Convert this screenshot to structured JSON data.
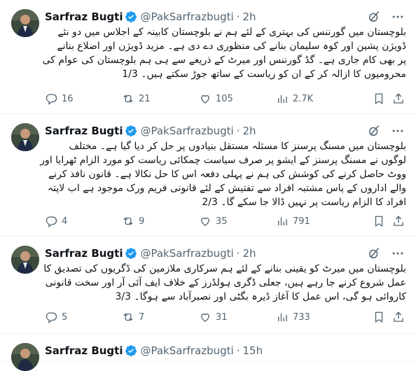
{
  "tweets": [
    {
      "name": "Sarfraz Bugti",
      "handle": "@PakSarfrazbugti",
      "time": "2h",
      "lines": [
        "بلوچستان میں گورننس کی بہتری کے لئے ہم نے بلوچستان کابینہ کے اجلاس میں  دو نئے",
        "ڈویژن  پشین اور کوہ سلیمان بنانے کی منظوری دے دی ہے۔ مزید ڈویژن اور اضلاع بنانے",
        "پر بھی کام جاری ہے۔ گڈ گورننس اور میرٹ کے ذریعے سے ہی ہم بلوچستان کی عوام کی",
        "محرومیوں کا ازالہ کر کے ان کو ریاست کے ساتھ جوڑ سکتے ہیں۔ 1/3"
      ],
      "replies": "16",
      "reposts": "21",
      "likes": "105",
      "views": "2.7K"
    },
    {
      "name": "Sarfraz Bugti",
      "handle": "@PakSarfrazbugti",
      "time": "2h",
      "lines": [
        "بلوچستان میں مسنگ پرسنز کا مسئلہ مستقل بنیادوں پر حل کر دیا گیا ہے۔ مختلف",
        "لوگوں نے مسنگ پرسنز کے ایشو پر صرف سیاست چمکائی ریاست کو مورد الزام ٹھرایا اور",
        "ووٹ حاصل کرنے کی کوشش کی ہم نے پہلی دفعہ اس کا حل نکالا ہے۔ قانون نافذ کرنے",
        "والے اداروں کے پاس مشتبہ افراد سے تفتیش کے لئے قانونی فریم ورک موجود ہے اب لاپتہ",
        "افراد کا الزام ریاست پر نہیں ڈالا جا سکے گا۔ 2/3"
      ],
      "replies": "4",
      "reposts": "9",
      "likes": "35",
      "views": "791"
    },
    {
      "name": "Sarfraz Bugti",
      "handle": "@PakSarfrazbugti",
      "time": "2h",
      "lines": [
        "بلوچستان میں میرٹ کو یقینی بنانے کے لئے ہم سرکاری ملازمین کی ڈگریوں کی تصدیق کا",
        "عمل شروع کرنے جا رہے ہیں، جعلی ڈگری ہولڈرز کے خلاف ایف آئی آر اور سخت قانونی",
        "کاروائی ہو گی، اس عمل کا آغاز ڈیرہ بگٹی اور نصیرآباد سے ہوگا۔ 3/3"
      ],
      "replies": "5",
      "reposts": "7",
      "likes": "31",
      "views": "733"
    },
    {
      "name": "Sarfraz Bugti",
      "handle": "@PakSarfrazbugti",
      "time": "15h"
    }
  ],
  "colors": {
    "text": "#0f1419",
    "secondary": "#536471",
    "verified": "#1d9bf0",
    "divider": "#eff3f4"
  }
}
